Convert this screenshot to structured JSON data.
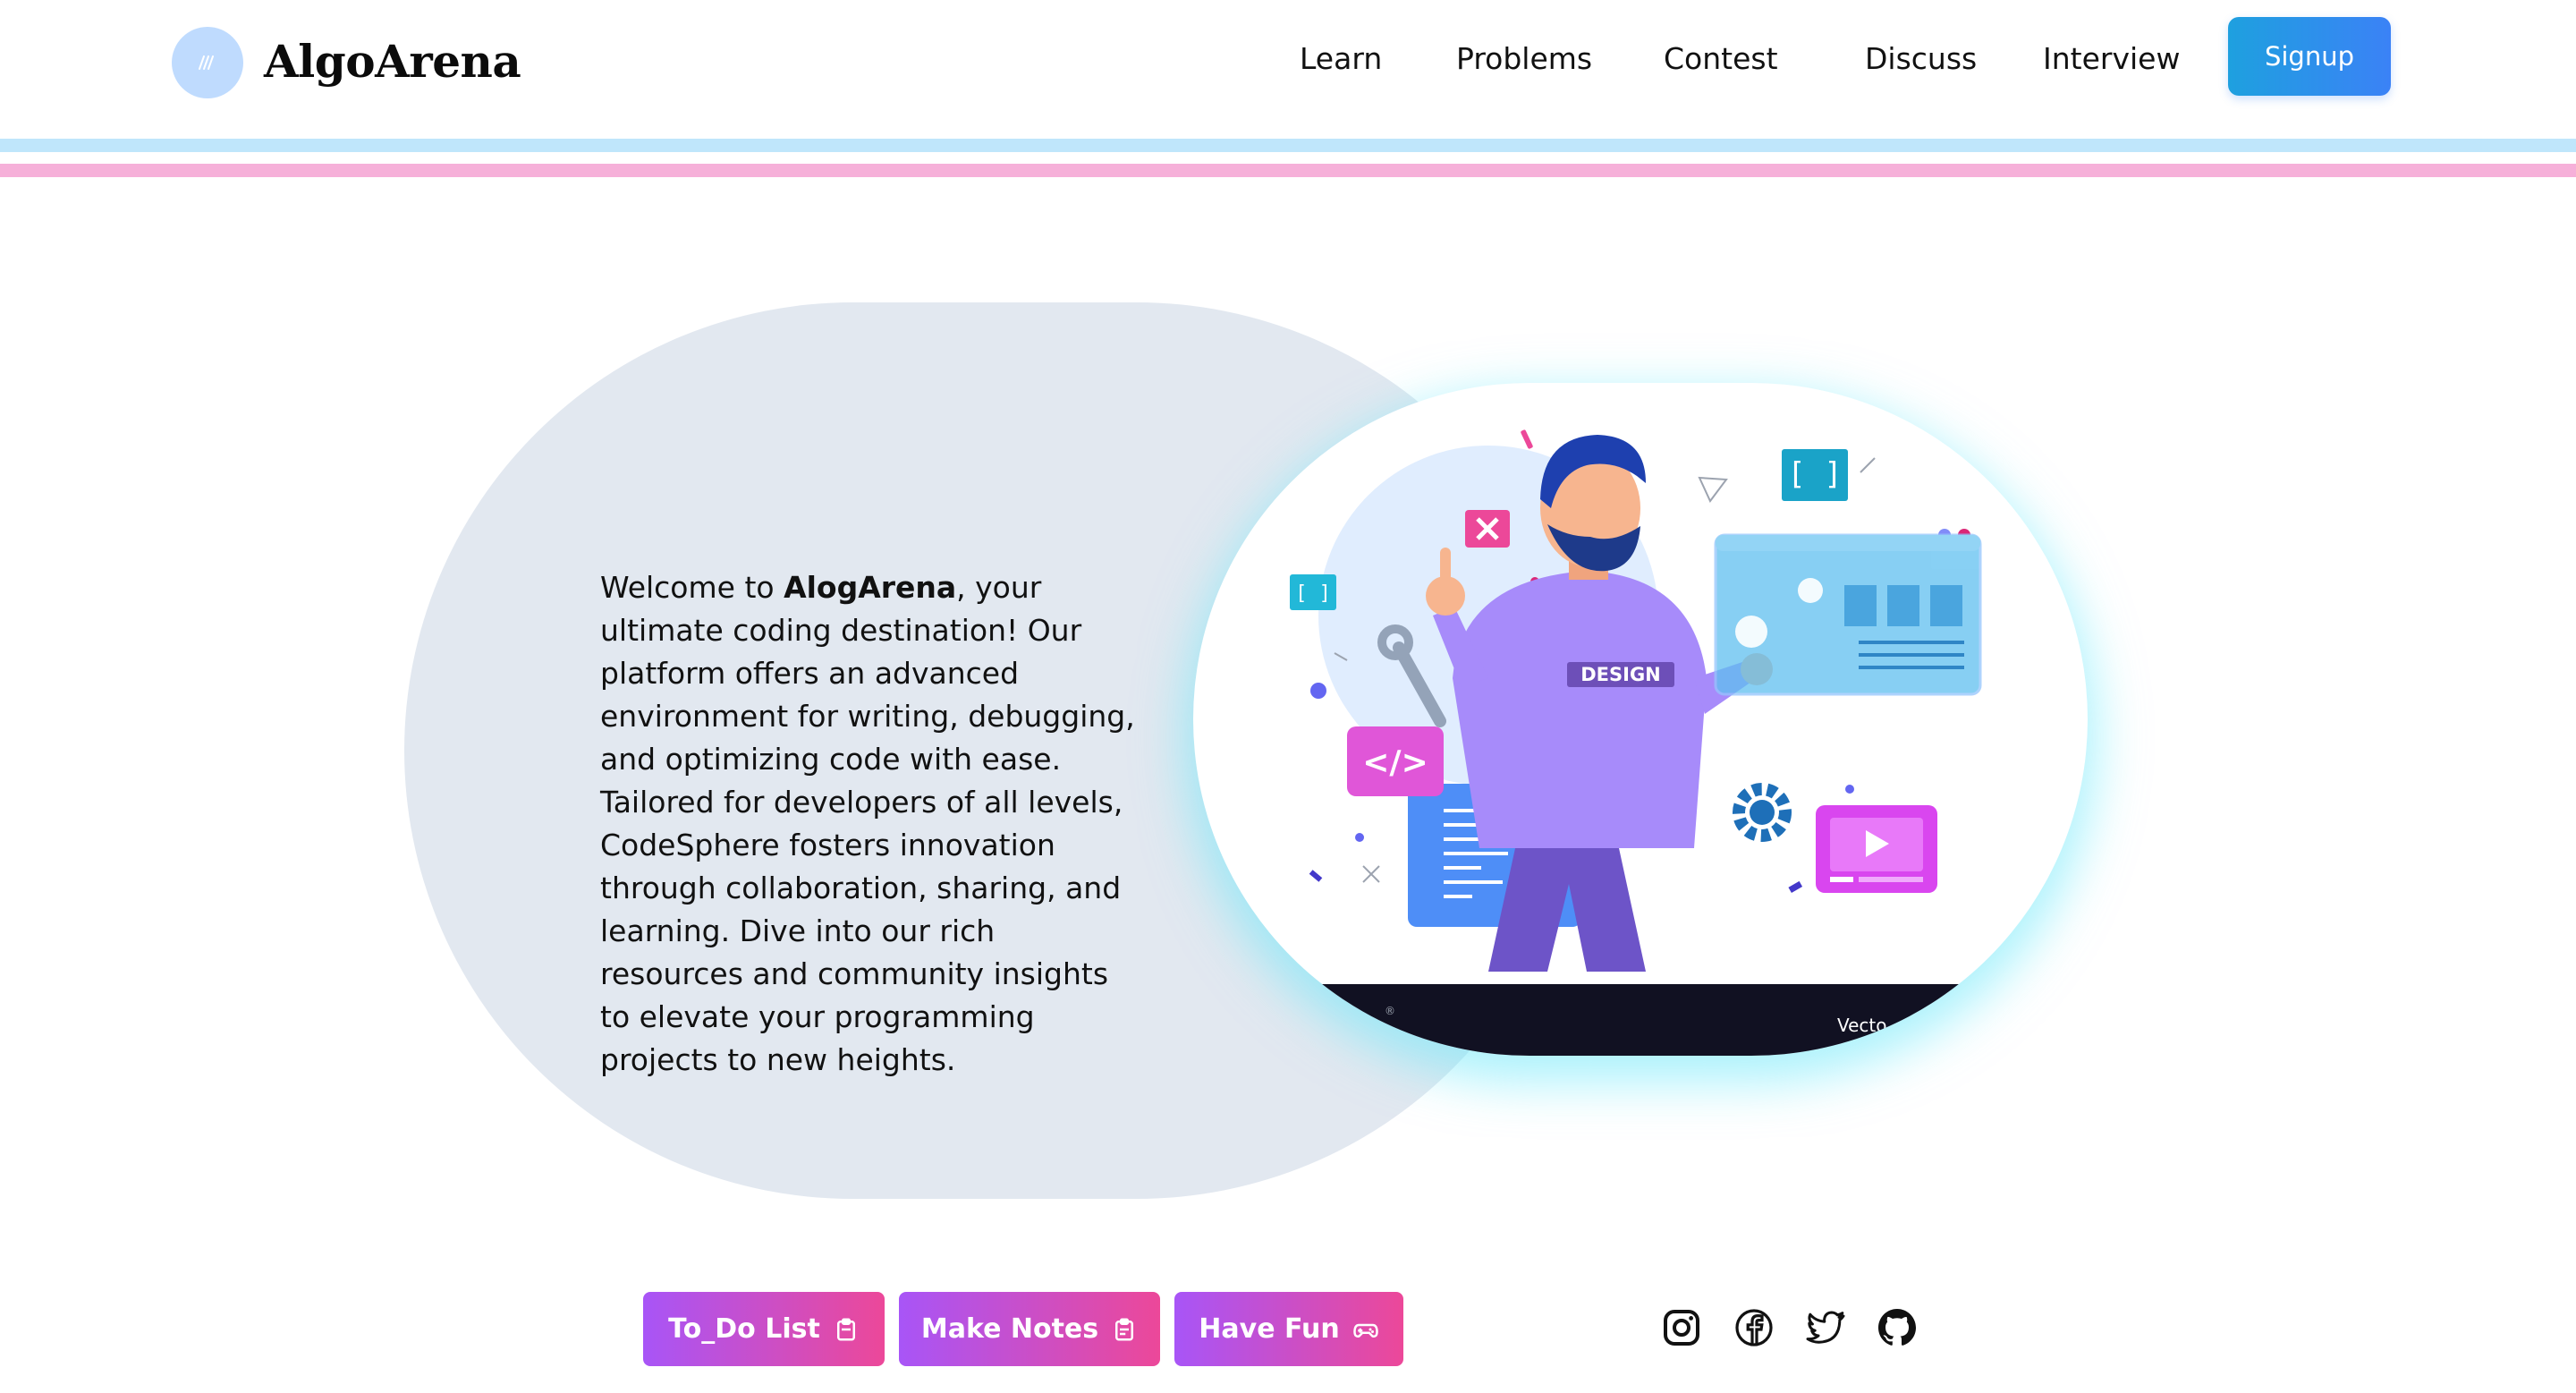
{
  "header": {
    "logo_icon": "algoarena-logo-icon",
    "brand": "AlgoArena",
    "nav": [
      "Learn",
      "Problems",
      "Contest",
      "Discuss",
      "Interview"
    ],
    "signup_label": "Signup"
  },
  "hero": {
    "intro_before": "Welcome to ",
    "intro_brand": "AlogArena",
    "intro_after": ", your ultimate coding destination! Our platform offers an advanced environment for writing, debugging, and optimizing code with ease. Tailored for developers of all levels, CodeSphere fosters innovation through collaboration, sharing, and learning. Dive into our rich resources and community insights to elevate your programming projects to new heights.",
    "illustration_badge": "DESIGN",
    "illustration_caption": "Vecto"
  },
  "actions": {
    "todo_label": "To_Do List",
    "notes_label": "Make Notes",
    "fun_label": "Have Fun"
  },
  "social": [
    "instagram-icon",
    "facebook-icon",
    "twitter-icon",
    "github-icon"
  ],
  "colors": {
    "accent_blue": "#3b82f6",
    "stripe_blue": "#bfe6fb",
    "stripe_pink": "#f6b0d9",
    "button_gradient_start": "#a855f7",
    "button_gradient_end": "#ec4899",
    "hero_blob": "#e2e8f0"
  }
}
